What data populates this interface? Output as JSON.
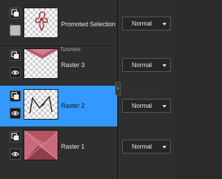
{
  "layers": [
    {
      "name": "Promoted Selection",
      "blend": "Normal",
      "selected": false
    },
    {
      "name": "Raster 3",
      "blend": "Normal",
      "selected": false
    },
    {
      "name": "Raster 2",
      "blend": "Normal",
      "selected": true
    },
    {
      "name": "Raster 1",
      "blend": "Normal",
      "selected": false
    }
  ],
  "watermark": "Tutoriels",
  "colors": {
    "selection": "#3399ff",
    "panel": "#2e2e2e",
    "pink": "#c86a78",
    "dark_pink": "#8e3d4a"
  },
  "icons": {
    "layer_type": "layers-icon",
    "visibility": "eye-icon",
    "mask": "mask-square-icon",
    "grip": "grip-arrow-icon"
  }
}
